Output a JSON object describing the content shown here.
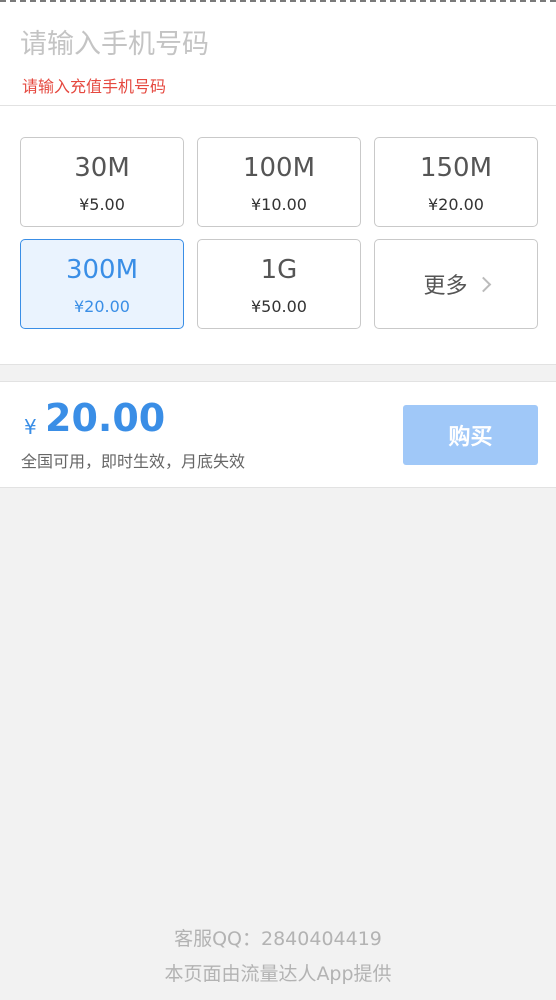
{
  "phone": {
    "value": "",
    "placeholder": "请输入手机号码",
    "error": "请输入充值手机号码"
  },
  "plans": [
    {
      "size": "30M",
      "price": "¥5.00",
      "selected": false
    },
    {
      "size": "100M",
      "price": "¥10.00",
      "selected": false
    },
    {
      "size": "150M",
      "price": "¥20.00",
      "selected": false
    },
    {
      "size": "300M",
      "price": "¥20.00",
      "selected": true
    },
    {
      "size": "1G",
      "price": "¥50.00",
      "selected": false
    }
  ],
  "more": {
    "label": "更多"
  },
  "summary": {
    "currency": "¥",
    "amount": "20.00",
    "note": "全国可用，即时生效，月底失效",
    "buy_label": "购买"
  },
  "footer": {
    "qq": "客服QQ：2840404419",
    "provider": "本页面由流量达人App提供"
  },
  "colors": {
    "accent": "#3a8ee6",
    "error": "#e5483f",
    "button_disabled": "#a0c8f8",
    "background": "#f2f2f2"
  }
}
